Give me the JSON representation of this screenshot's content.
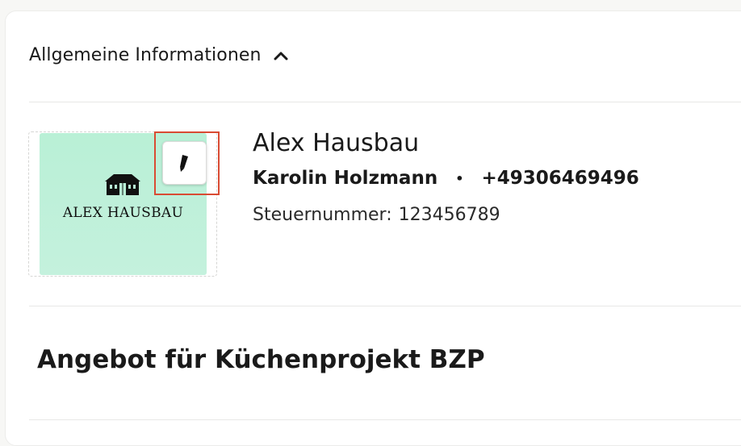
{
  "section": {
    "title": "Allgemeine Informationen",
    "expanded_icon": "chevron-up-icon"
  },
  "company": {
    "logo_text": "ALEX HAUSBAU",
    "logo_bg_color": "#c4f1dd",
    "edit_icon": "pencil-icon",
    "name": "Alex Hausbau",
    "contact_person": "Karolin Holzmann",
    "separator": "•",
    "phone": "+49306469496",
    "tax_label": "Steuernummer:",
    "tax_number": "123456789"
  },
  "offer": {
    "title": "Angebot für Küchenprojekt BZP"
  },
  "colors": {
    "highlight": "#d94b33"
  }
}
